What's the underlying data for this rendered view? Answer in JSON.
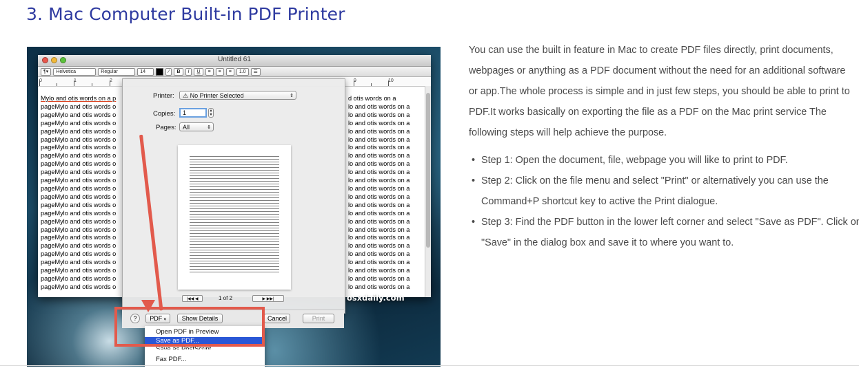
{
  "article": {
    "heading": "3. Mac Computer Built-in PDF Printer",
    "intro": "You can use the built in feature in Mac to create PDF files directly, print documents, webpages or anything as a PDF document without the need for an additional software or app.The whole process is simple and in just few steps, you should be able to print to PDF.It works basically on exporting the file as a PDF on the Mac print service The following steps will help achieve the purpose.",
    "steps": [
      "Step 1: Open the document, file, webpage you will like to print to PDF.",
      "Step 2: Click on the file menu and select \"Print\" or alternatively you can use the Command+P shortcut key to active the Print dialogue.",
      "Step 3: Find the PDF button in the lower left corner and select \"Save as PDF\". Click on \"Save\" in the dialog box and save it to where you want to."
    ]
  },
  "screenshot": {
    "window_title": "Untitled 61",
    "toolbar": {
      "font_family": "Helvetica",
      "font_style": "Regular",
      "font_size": "14",
      "bold": "B",
      "italic": "I",
      "underline": "U",
      "line_spacing": "1.0"
    },
    "ruler_numbers": [
      "0",
      "1",
      "2",
      "9",
      "10"
    ],
    "doc_first_left": "Mylo and otis words on a p",
    "doc_line_left": "pageMylo and otis words o",
    "doc_first_right": "d otis words on a",
    "doc_line_right": "lo and otis words on a",
    "print_dialog": {
      "printer_label": "Printer:",
      "printer_value": "No Printer Selected",
      "copies_label": "Copies:",
      "copies_value": "1",
      "pages_label": "Pages:",
      "pages_value": "All",
      "page_indicator": "1 of 2",
      "help": "?",
      "pdf_button": "PDF",
      "show_details": "Show Details",
      "cancel": "Cancel",
      "print": "Print"
    },
    "pdf_menu": {
      "items": [
        "Open PDF in Preview",
        "Save as PDF...",
        "Save as PostScript...",
        "Fax PDF..."
      ],
      "selected_index": 1
    },
    "watermark": "osxdaily.com",
    "annotation_color": "#e25a4c"
  }
}
